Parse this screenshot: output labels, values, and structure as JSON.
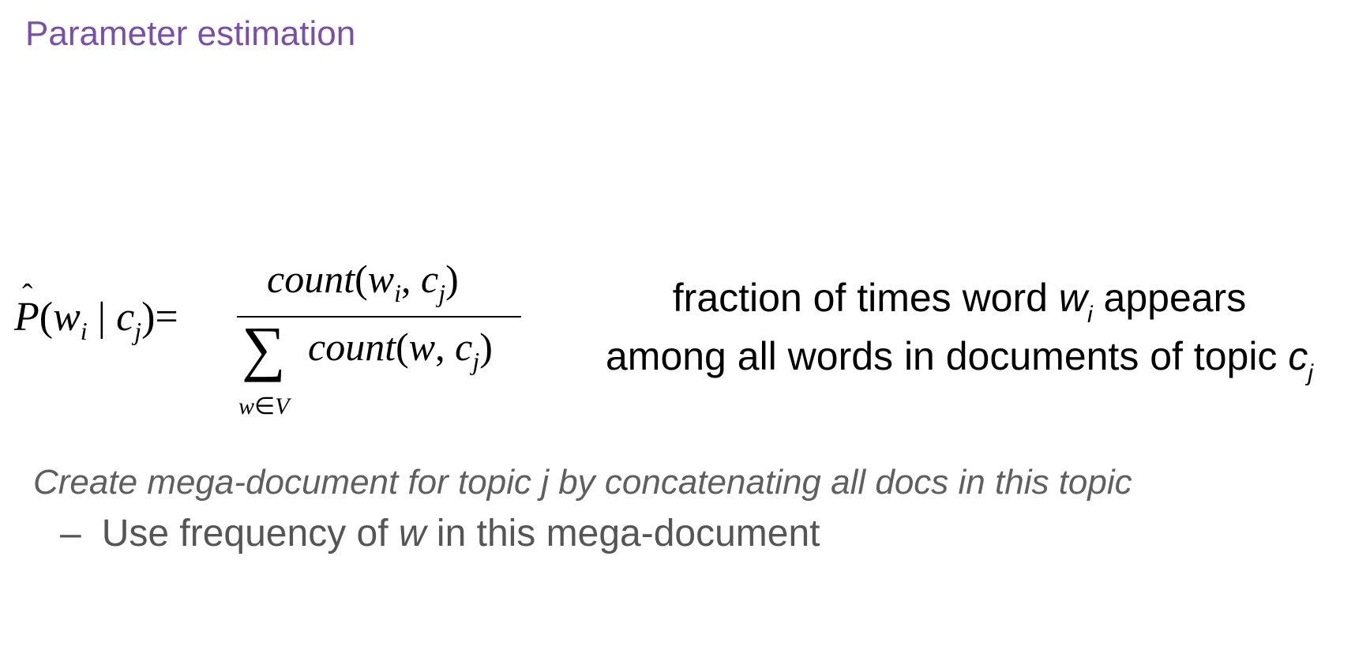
{
  "slide": {
    "title": "Parameter estimation"
  },
  "formula": {
    "lhs_P": "P",
    "lhs_hat": "ˆ",
    "lhs_open": "(",
    "lhs_w": "w",
    "lhs_i": "i",
    "lhs_bar": " | ",
    "lhs_c": "c",
    "lhs_j": "j",
    "lhs_close": ")",
    "equals": "=",
    "num_count": "count",
    "num_open": "(",
    "num_w": "w",
    "num_i": "i",
    "num_comma": ", ",
    "num_c": "c",
    "num_j": "j",
    "num_close": ")",
    "sigma": "∑",
    "den_count": "count",
    "den_open": "(",
    "den_w": "w",
    "den_comma": ", ",
    "den_c": "c",
    "den_j": "j",
    "den_close": ")",
    "sum_under_w": "w",
    "sum_under_in": "∈",
    "sum_under_V": "V"
  },
  "explanation": {
    "line1_pre": "fraction of times word ",
    "line1_var": "w",
    "line1_sub": "i",
    "line1_post": " appears",
    "line2_pre": "among all words in documents of topic ",
    "line2_var": "c",
    "line2_sub": "j"
  },
  "notes": {
    "italic_line": "Create mega-document for topic j by concatenating all docs in this topic",
    "bullet_dash": "–",
    "bullet_pre": "Use frequency of ",
    "bullet_var": "w",
    "bullet_post": " in this mega-document"
  },
  "colors": {
    "title": "#7a4fa8",
    "body_text": "#000000",
    "note_text": "#5f5f5f"
  }
}
